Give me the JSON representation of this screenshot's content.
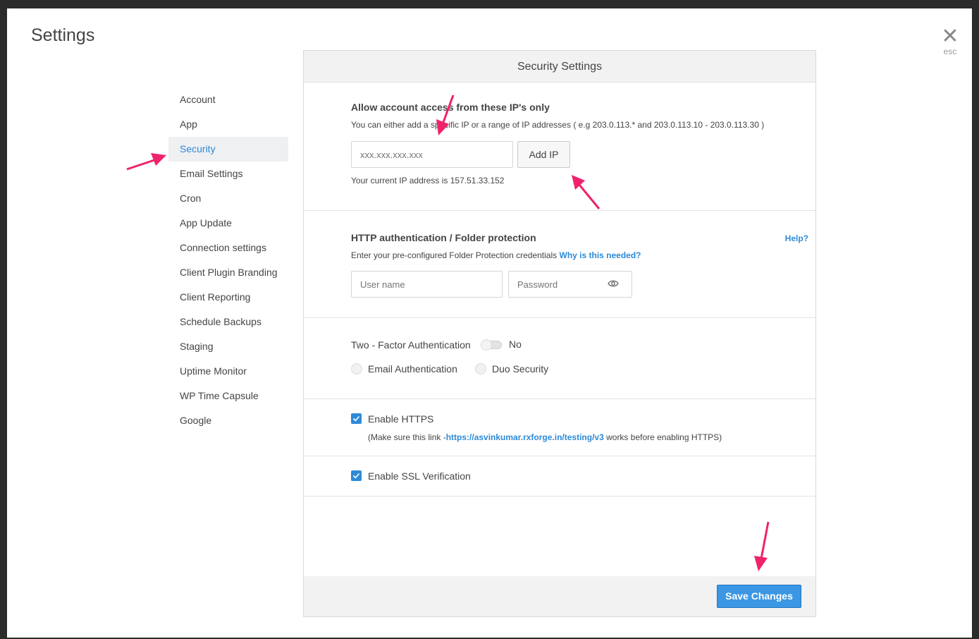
{
  "modal": {
    "title": "Settings",
    "close_icon_glyph": "✕",
    "close_hint": "esc"
  },
  "sidebar": {
    "items": [
      {
        "label": "Account"
      },
      {
        "label": "App"
      },
      {
        "label": "Security",
        "active": true
      },
      {
        "label": "Email Settings"
      },
      {
        "label": "Cron"
      },
      {
        "label": "App Update"
      },
      {
        "label": "Connection settings"
      },
      {
        "label": "Client Plugin Branding"
      },
      {
        "label": "Client Reporting"
      },
      {
        "label": "Schedule Backups"
      },
      {
        "label": "Staging"
      },
      {
        "label": "Uptime Monitor"
      },
      {
        "label": "WP Time Capsule"
      },
      {
        "label": "Google"
      }
    ]
  },
  "panel": {
    "header": "Security Settings",
    "ip_access": {
      "title": "Allow account access from these IP's only",
      "description": "You can either add a specific IP or a range of IP addresses ( e.g 203.0.113.* and 203.0.113.10 - 203.0.113.30 )",
      "input_placeholder": "xxx.xxx.xxx.xxx",
      "input_value": "",
      "add_button": "Add IP",
      "current_ip_text": "Your current IP address is 157.51.33.152"
    },
    "http_auth": {
      "title": "HTTP authentication / Folder protection",
      "help_link": "Help?",
      "description": "Enter your pre-configured Folder Protection credentials",
      "why_link": "Why is this needed?",
      "username_placeholder": "User name",
      "password_placeholder": "Password"
    },
    "two_factor": {
      "title": "Two - Factor Authentication",
      "toggle_state": "No",
      "enabled": false,
      "options": [
        {
          "label": "Email Authentication",
          "selected": false
        },
        {
          "label": "Duo Security",
          "selected": false
        }
      ]
    },
    "https": {
      "label": "Enable HTTPS",
      "checked": true,
      "note_prefix": "(Make sure this link -",
      "note_link": "https://asvinkumar.rxforge.in/testing/v3",
      "note_suffix": " works before enabling HTTPS)"
    },
    "ssl": {
      "label": "Enable SSL Verification",
      "checked": true
    },
    "save_button": "Save Changes"
  },
  "colors": {
    "accent": "#2d8ad8",
    "save_button": "#3b97e3",
    "annotation_arrow": "#f0226b"
  },
  "icons": {
    "close": "close-icon",
    "password_visibility": "eye-icon",
    "checkbox": "check-icon",
    "annotations": "arrow-icon"
  }
}
